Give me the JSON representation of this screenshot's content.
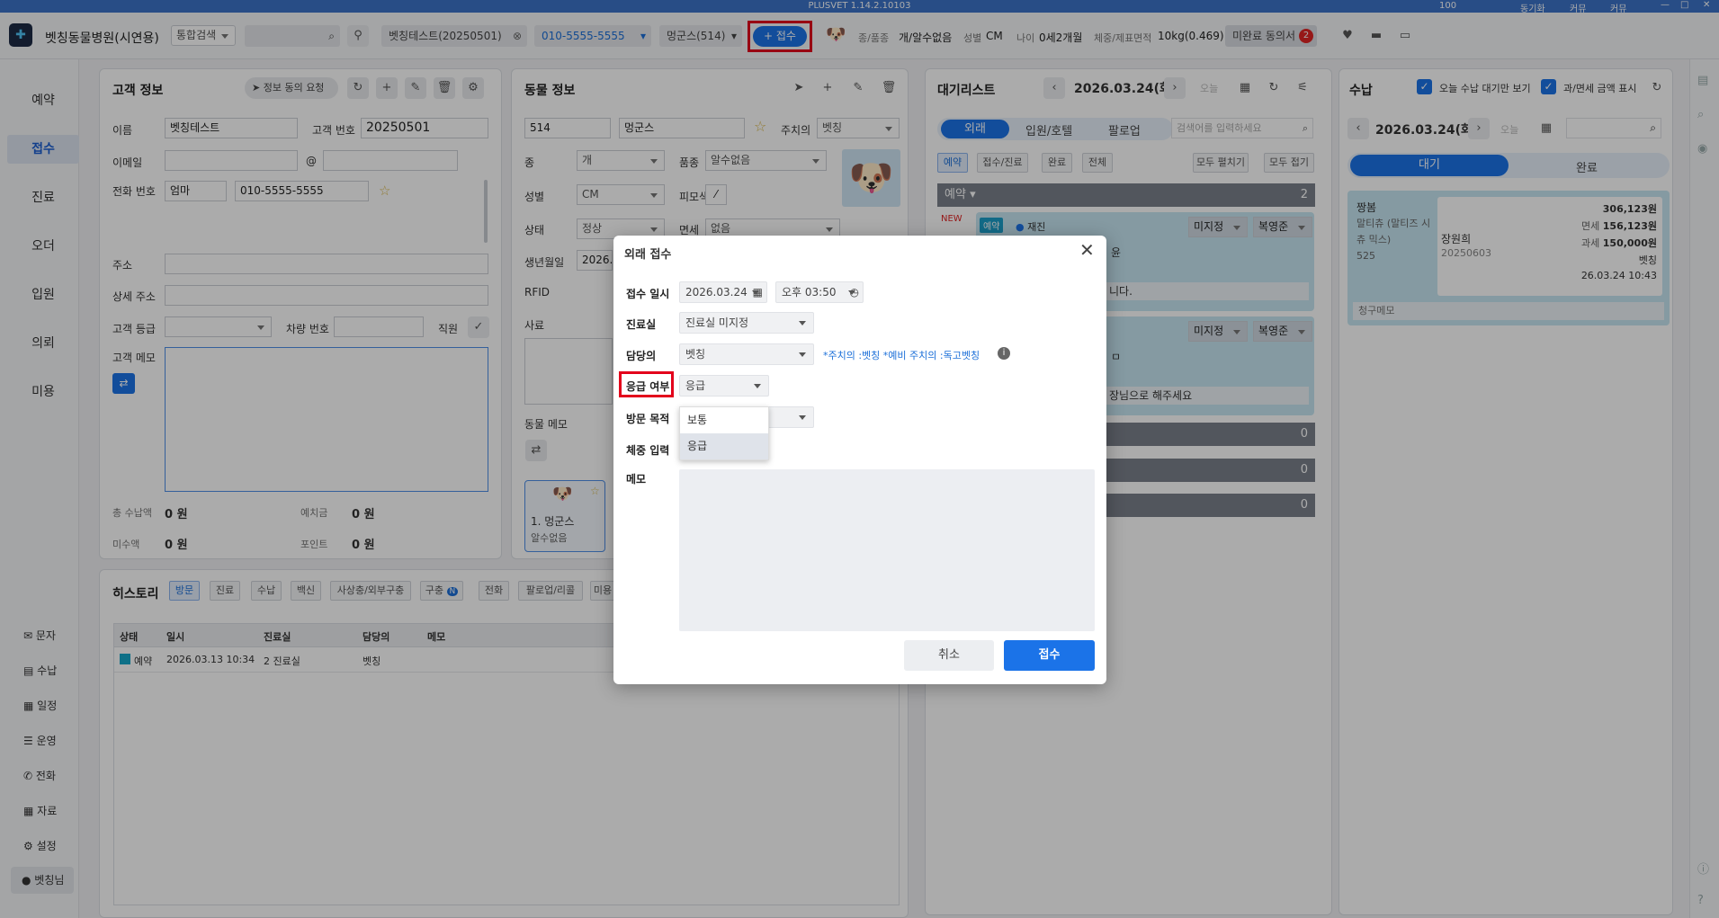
{
  "titlebar": {
    "title": "PLUSVET 1.14.2.10103",
    "zoom": "100",
    "controls": [
      "동기화",
      "커뮤",
      "커뮤"
    ]
  },
  "header": {
    "hospital": "벳칭동물병원(시연용)",
    "search_scope": "통합검색",
    "client": "벳칭테스트(20250501)",
    "phone": "010-5555-5555",
    "pet": "멍군스(514)",
    "receive_btn": "+ 접수",
    "species_label": "종/품종",
    "species_value": "개/알수없음",
    "sex_label": "성별",
    "sex_value": "CM",
    "age_label": "나이",
    "age_value": "0세2개월",
    "weight_label": "체중/제표면적",
    "weight_value": "10kg(0.469)",
    "unfinished": "미완료 동의서",
    "unfinished_count": "2"
  },
  "leftnav": {
    "items": [
      "예약",
      "접수",
      "진료",
      "오더",
      "입원",
      "의뢰",
      "미용"
    ],
    "bottom": [
      "문자",
      "수납",
      "일정",
      "운영",
      "전화",
      "자료",
      "설정",
      "벳칭님"
    ]
  },
  "client": {
    "title": "고객 정보",
    "consent_btn": "정보 동의 요청",
    "name_label": "이름",
    "name": "벳칭테스트",
    "no_label": "고객 번호",
    "no": "20250501",
    "email_label": "이메일",
    "at": "@",
    "phone_label": "전화 번호",
    "phone_owner": "엄마",
    "phone": "010-5555-5555",
    "address_label": "주소",
    "address2_label": "상세 주소",
    "grade_label": "고객 등급",
    "car_label": "차량 번호",
    "staff_label": "직원",
    "memo_label": "고객 메모",
    "total_label": "총 수납액",
    "total": "0 원",
    "deposit_label": "예치금",
    "deposit": "0 원",
    "unpaid_label": "미수액",
    "unpaid": "0 원",
    "point_label": "포인트",
    "point": "0 원"
  },
  "animal": {
    "title": "동물 정보",
    "no": "514",
    "name": "멍군스",
    "vet_label": "주치의",
    "vet": "벳칭",
    "species_label": "종",
    "species": "개",
    "breed_label": "품종",
    "breed": "알수없음",
    "sex_label": "성별",
    "sex": "CM",
    "coat_label": "피모색",
    "state_label": "상태",
    "state": "정상",
    "tax_label": "면세",
    "tax": "없음",
    "birth_label": "생년월일",
    "birth": "2026.0",
    "rfid_label": "RFID",
    "death_label": "사료",
    "memo_label": "동물 메모",
    "card_name": "1. 멍군스",
    "card_breed": "알수없음"
  },
  "history": {
    "title": "히스토리",
    "tabs": [
      "방문",
      "진료",
      "수납",
      "백신",
      "사상충/외부구충",
      "구충",
      "전화",
      "팔로업/리콜",
      "미용"
    ],
    "badge": "N",
    "columns": [
      "상태",
      "일시",
      "진료실",
      "담당의",
      "메모"
    ],
    "rows": [
      {
        "status": "예약",
        "date": "2026.03.13 10:34",
        "room": "2 진료실",
        "doctor": "벳칭",
        "memo": ""
      }
    ]
  },
  "waitlist": {
    "title": "대기리스트",
    "date": "2026.03.24(화)",
    "today": "오늘",
    "tabs": [
      "외래",
      "입원/호텔",
      "팔로업"
    ],
    "search_placeholder": "검색어를 입력하세요",
    "filters": [
      "예약",
      "접수/진료",
      "완료",
      "전체"
    ],
    "expand_all": "모두 펼치기",
    "collapse_all": "모두 접기",
    "group_label": "예약",
    "group_count": "2",
    "new_tag": "NEW",
    "card1_tag": "예약",
    "card1_status": "재진",
    "dd1": "미지정",
    "dd2": "복영준",
    "card1_text1": "윤",
    "card1_text2": "니다.",
    "card2_text1": "ㅁ",
    "card2_text2": "장님으로 해주세요",
    "counts": [
      "0",
      "0",
      "0"
    ]
  },
  "payment": {
    "title": "수납",
    "chk1": "오늘 수납 대기만 보기",
    "chk2": "과/면세 금액 표시",
    "date": "2026.03.24(화)",
    "today": "오늘",
    "tab_wait": "대기",
    "tab_done": "완료",
    "pet_name": "짱봄",
    "pet_breed": "말티츄 (말티즈 시츄 믹스)",
    "pet_no": "525",
    "owner_name": "장원희",
    "owner_no": "20250603",
    "amount": "306,123원",
    "taxfree_label": "면세",
    "taxfree": "156,123원",
    "tax_label": "과세",
    "tax": "150,000원",
    "doctor": "벳칭",
    "datetime": "26.03.24 10:43",
    "memo_label": "청구메모"
  },
  "modal": {
    "title": "외래 접수",
    "date_label": "접수 일시",
    "date": "2026.03.24",
    "time": "오후 03:50",
    "room_label": "진료실",
    "room": "진료실 미지정",
    "doctor_label": "담당의",
    "doctor": "벳칭",
    "doctor_note": "*주치의 :벳칭 *예비 주치의 :독고벳칭",
    "urgent_label": "응급 여부",
    "urgent": "응급",
    "options": [
      "보통",
      "응급"
    ],
    "purpose_label": "방문 목적",
    "weight_label": "체중 입력",
    "memo_label": "메모",
    "cancel": "취소",
    "submit": "접수"
  }
}
